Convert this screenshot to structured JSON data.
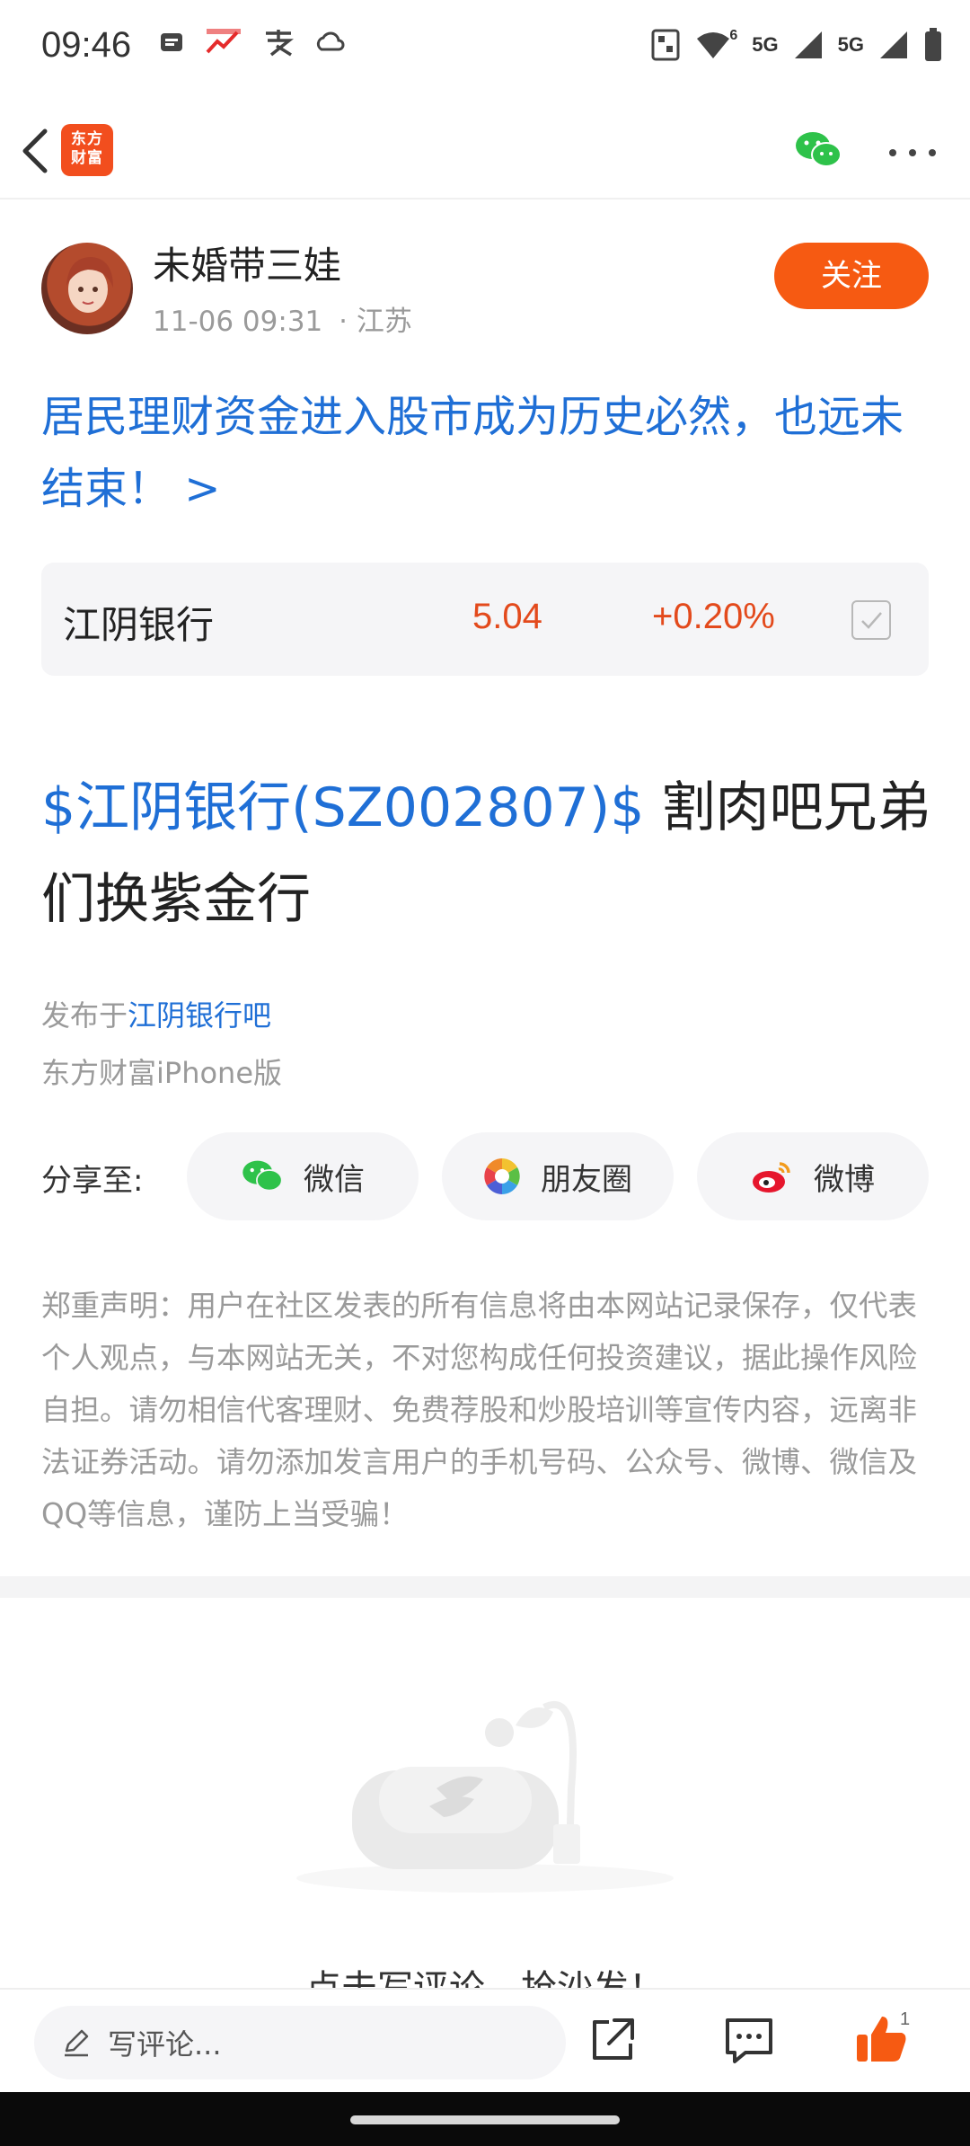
{
  "status_bar": {
    "time": "09:46",
    "signal_label_1": "5G",
    "signal_label_2": "5G",
    "signal_superscript": "6"
  },
  "nav": {
    "logo_line1": "东方",
    "logo_line2": "财富",
    "icons": [
      "back-arrow",
      "wechat",
      "more"
    ]
  },
  "author": {
    "name": "未婚带三娃",
    "date": "11-06 09:31",
    "location": "· 江苏",
    "follow_label": "关注"
  },
  "topic": {
    "title": "居民理财资金进入股市成为历史必然，也远未结束！ >"
  },
  "stock_card": {
    "name": "江阴银行",
    "price": "5.04",
    "change": "+0.20%",
    "colors": {
      "up": "#e34a1c"
    }
  },
  "post": {
    "stock_tag": "$江阴银行(SZ002807)$",
    "content": " 割肉吧兄弟们换紫金行"
  },
  "publish": {
    "prefix": "发布于",
    "bar_name": "江阴银行吧",
    "platform": "东方财富iPhone版"
  },
  "share": {
    "label": "分享至:",
    "options": [
      {
        "label": "微信",
        "icon": "wechat-icon"
      },
      {
        "label": "朋友圈",
        "icon": "moments-icon"
      },
      {
        "label": "微博",
        "icon": "weibo-icon"
      }
    ]
  },
  "disclaimer": {
    "text": "郑重声明：用户在社区发表的所有信息将由本网站记录保存，仅代表个人观点，与本网站无关，不对您构成任何投资建议，据此操作风险自担。请勿相信代客理财、免费荐股和炒股培训等宣传内容，远离非法证券活动。请勿添加发言用户的手机号码、公众号、微博、微信及QQ等信息，谨防上当受骗！"
  },
  "empty_state": {
    "text": "点击写评论，抢沙发！"
  },
  "bottom_bar": {
    "comment_placeholder": "写评论...",
    "like_count": "1"
  },
  "colors": {
    "brand": "#f24e1e",
    "link": "#1f6fd6",
    "follow": "#f65a12",
    "muted": "#9a9a9a"
  }
}
